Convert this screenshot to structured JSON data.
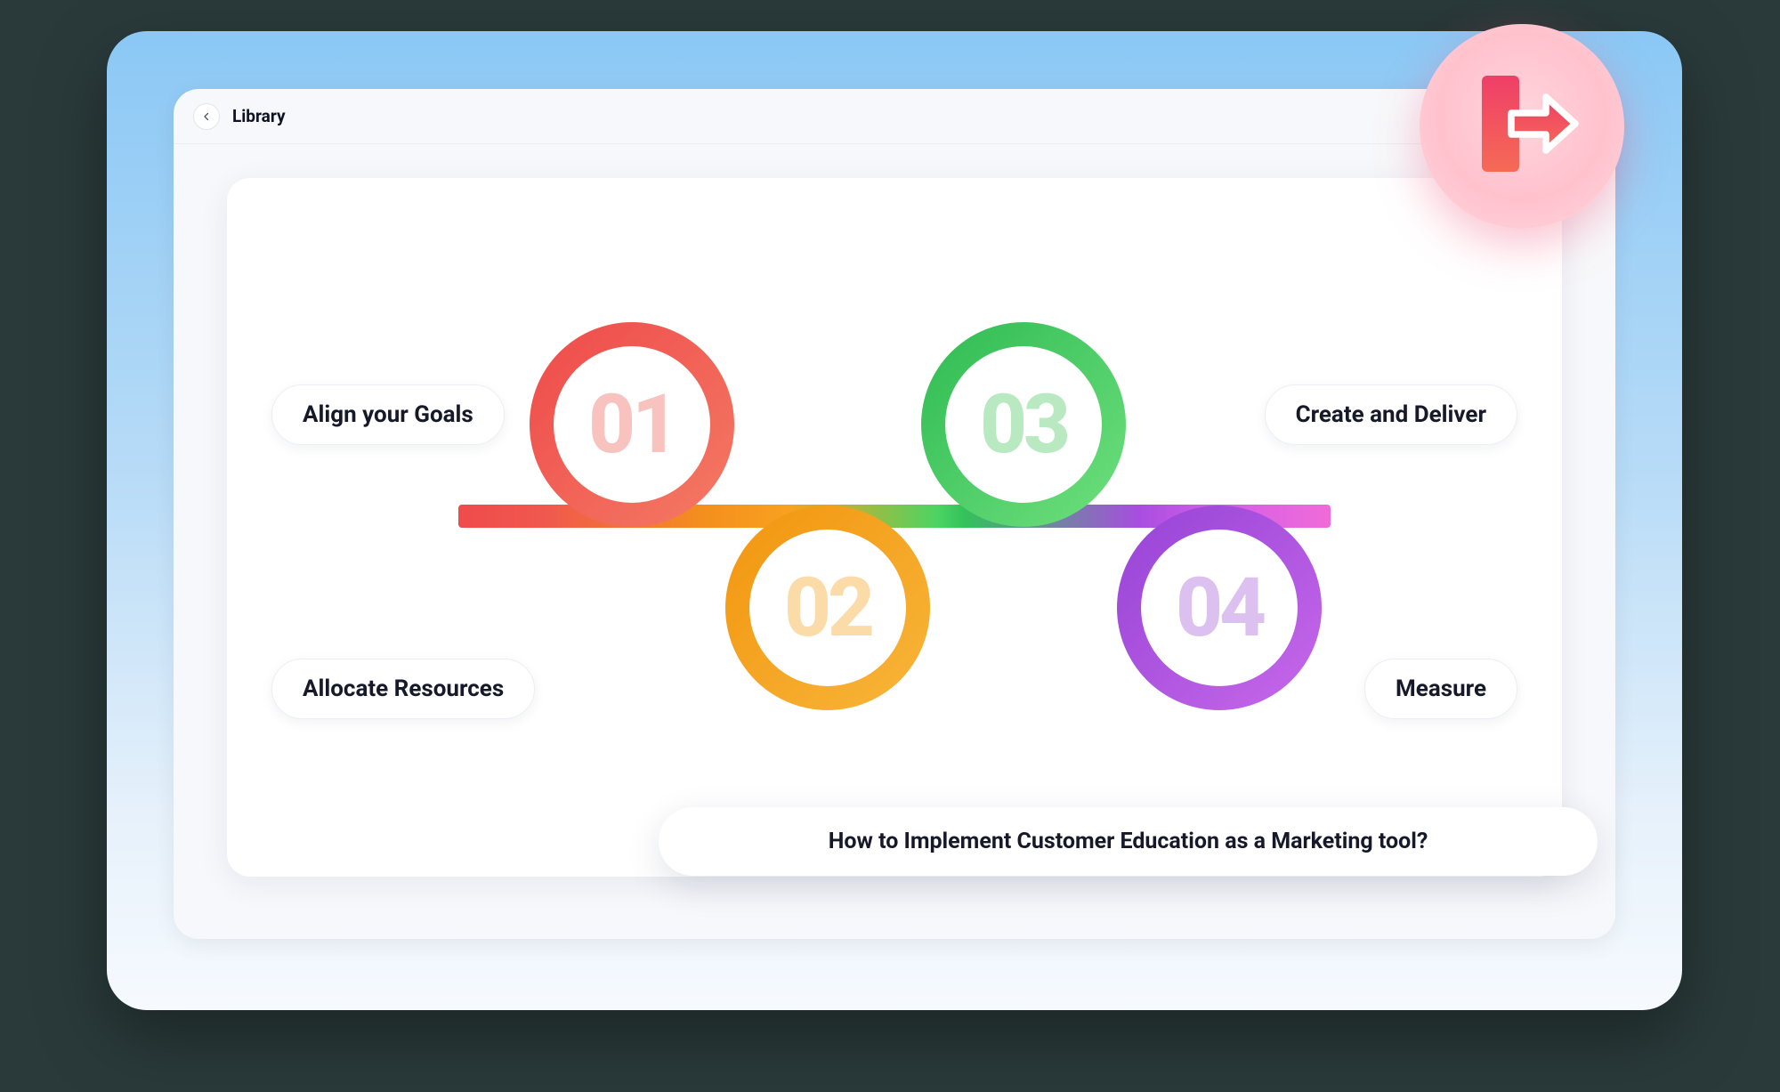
{
  "header": {
    "breadcrumb": "Library"
  },
  "steps": [
    {
      "num": "01",
      "label": "Align your Goals"
    },
    {
      "num": "02",
      "label": "Allocate Resources"
    },
    {
      "num": "03",
      "label": "Create and Deliver"
    },
    {
      "num": "04",
      "label": "Measure"
    }
  ],
  "question": "How to Implement Customer Education as a Marketing tool?"
}
